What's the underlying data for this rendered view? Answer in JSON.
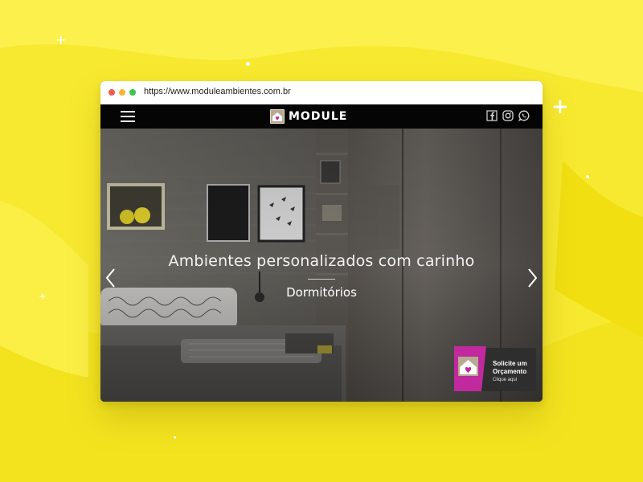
{
  "browser": {
    "url": "https://www.moduleambientes.com.br"
  },
  "navbar": {
    "brand": "MODULE",
    "social_icons": [
      "facebook-icon",
      "instagram-icon",
      "whatsapp-icon"
    ]
  },
  "hero": {
    "title": "Ambientes personalizados com carinho",
    "subtitle": "Dormitórios"
  },
  "cta": {
    "line1": "Solicite um",
    "line2": "Orçamento",
    "line3": "Clique aqui"
  },
  "colors": {
    "background": "#f7e92f",
    "accent_magenta": "#c02a9e",
    "navbar": "#050505"
  }
}
